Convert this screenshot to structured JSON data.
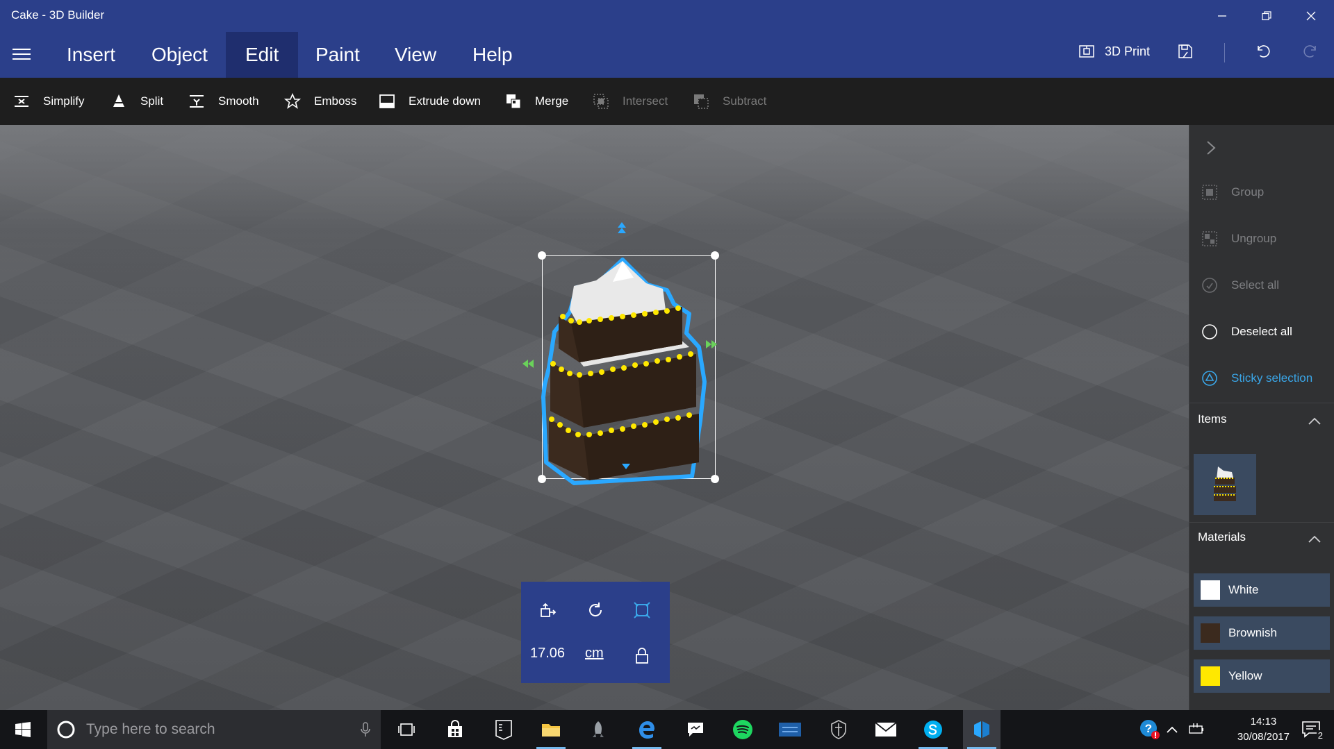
{
  "window": {
    "title": "Cake - 3D Builder"
  },
  "menu": {
    "tabs": [
      "Insert",
      "Object",
      "Edit",
      "Paint",
      "View",
      "Help"
    ],
    "active_tab": "Edit",
    "print_label": "3D Print"
  },
  "toolbar": {
    "items": [
      {
        "label": "Simplify",
        "icon": "simplify-icon",
        "enabled": true
      },
      {
        "label": "Split",
        "icon": "split-icon",
        "enabled": true
      },
      {
        "label": "Smooth",
        "icon": "smooth-icon",
        "enabled": true
      },
      {
        "label": "Emboss",
        "icon": "star-icon",
        "enabled": true
      },
      {
        "label": "Extrude down",
        "icon": "extrude-down-icon",
        "enabled": true
      },
      {
        "label": "Merge",
        "icon": "merge-icon",
        "enabled": true
      },
      {
        "label": "Intersect",
        "icon": "intersect-icon",
        "enabled": false
      },
      {
        "label": "Subtract",
        "icon": "subtract-icon",
        "enabled": false
      }
    ]
  },
  "transform": {
    "size_value": "17.06",
    "unit": "cm"
  },
  "right_panel": {
    "actions": [
      {
        "label": "Group",
        "icon": "group-icon",
        "state": "disabled"
      },
      {
        "label": "Ungroup",
        "icon": "ungroup-icon",
        "state": "disabled"
      },
      {
        "label": "Select all",
        "icon": "select-all-icon",
        "state": "disabled"
      },
      {
        "label": "Deselect all",
        "icon": "deselect-all-icon",
        "state": "enabled"
      },
      {
        "label": "Sticky selection",
        "icon": "sticky-selection-icon",
        "state": "accent"
      }
    ],
    "items_title": "Items",
    "materials_title": "Materials",
    "materials": [
      {
        "name": "White",
        "color": "#ffffff"
      },
      {
        "name": "Brownish",
        "color": "#3b2a1e"
      },
      {
        "name": "Yellow",
        "color": "#ffe800"
      }
    ]
  },
  "taskbar": {
    "search_placeholder": "Type here to search",
    "time": "14:13",
    "date": "30/08/2017",
    "notification_count": "2"
  },
  "colors": {
    "menubar": "#2b3f8a",
    "accent": "#3aa6e8",
    "selection_outline": "#2aa8ff"
  }
}
